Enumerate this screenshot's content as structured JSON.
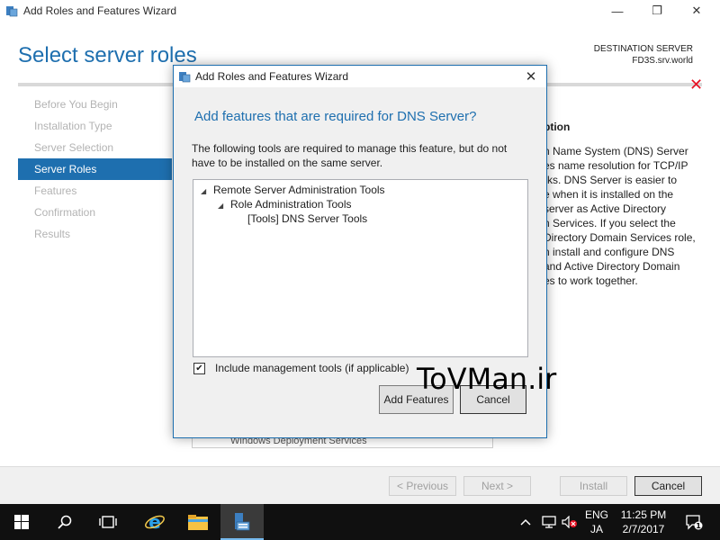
{
  "window": {
    "title": "Add Roles and Features Wizard",
    "controls": {
      "minimize": "—",
      "maximize": "❐",
      "close": "✕"
    }
  },
  "page": {
    "heading": "Select server roles",
    "destination_label": "DESTINATION SERVER",
    "destination_server": "FD3S.srv.world"
  },
  "steps": [
    {
      "label": "Before You Begin",
      "active": false
    },
    {
      "label": "Installation Type",
      "active": false
    },
    {
      "label": "Server Selection",
      "active": false
    },
    {
      "label": "Server Roles",
      "active": true
    },
    {
      "label": "Features",
      "active": false
    },
    {
      "label": "Confirmation",
      "active": false
    },
    {
      "label": "Results",
      "active": false
    }
  ],
  "description": {
    "title": "ption",
    "lines": [
      "n Name System (DNS) Server",
      "es name resolution for TCP/IP",
      "rks. DNS Server is easier to",
      "e when it is installed on the",
      "server as Active Directory",
      "n Services. If you select the",
      "Directory Domain Services role,",
      "n install and configure DNS",
      "and Active Directory Domain",
      "es to work together."
    ]
  },
  "behind_list_item": "Windows Deployment Services",
  "footer_buttons": {
    "previous": "< Previous",
    "next": "Next >",
    "install": "Install",
    "cancel": "Cancel"
  },
  "dialog": {
    "title": "Add Roles and Features Wizard",
    "close": "✕",
    "heading": "Add features that are required for DNS Server?",
    "text": "The following tools are required to manage this feature, but do not have to be installed on the same server.",
    "tree": [
      {
        "label": "Remote Server Administration Tools",
        "level": 0,
        "expanded": true
      },
      {
        "label": "Role Administration Tools",
        "level": 1,
        "expanded": true
      },
      {
        "label": "[Tools] DNS Server Tools",
        "level": 2,
        "expanded": false
      }
    ],
    "include_tools_label": "Include management tools (if applicable)",
    "include_tools_checked": true,
    "add_features_label": "Add Features",
    "cancel_label": "Cancel"
  },
  "watermark": "ToVMan.ir",
  "taskbar": {
    "language_top": "ENG",
    "language_bottom": "JA",
    "time": "11:25 PM",
    "date": "2/7/2017",
    "notification_count": "1"
  },
  "colors": {
    "accent": "#1e6faf",
    "taskbar": "#101010",
    "error": "#e81123"
  }
}
